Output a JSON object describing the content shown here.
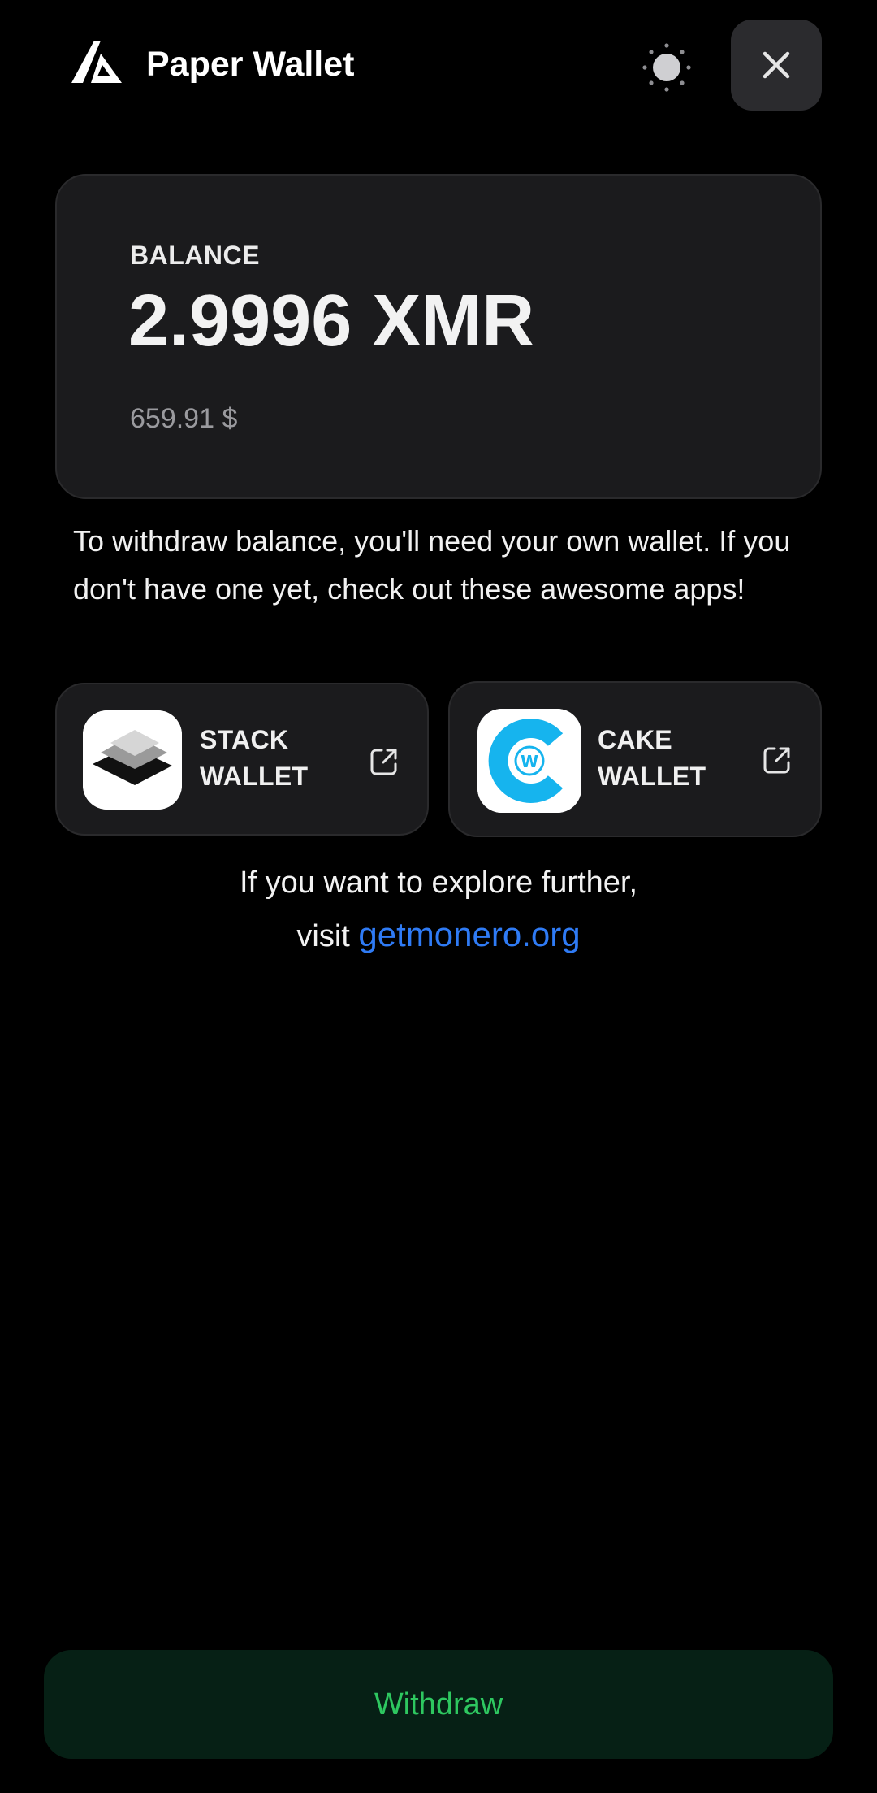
{
  "header": {
    "title": "Paper Wallet",
    "logo_icon": "app-logo-icon",
    "theme_icon": "sun-icon",
    "close_icon": "close-icon"
  },
  "balance": {
    "label": "BALANCE",
    "amount": "2.9996 XMR",
    "fiat": "659.91 $"
  },
  "info": {
    "text": "To withdraw balance, you'll need your own wallet. If you don't have one yet, check out these awesome apps!"
  },
  "wallets": [
    {
      "name": "STACK WALLET",
      "icon": "stack-wallet-icon",
      "link_icon": "external-link-icon"
    },
    {
      "name": "CAKE WALLET",
      "icon": "cake-wallet-icon",
      "link_icon": "external-link-icon"
    }
  ],
  "explore": {
    "line1": "If you want to explore further,",
    "prefix": "visit",
    "link_text": "getmonero.org"
  },
  "actions": {
    "withdraw_label": "Withdraw"
  },
  "colors": {
    "background": "#000000",
    "card": "#1b1b1d",
    "link": "#2f7bf5",
    "withdraw_bg": "#062015",
    "withdraw_text": "#2ec760",
    "cake_blue": "#16b4ee"
  }
}
